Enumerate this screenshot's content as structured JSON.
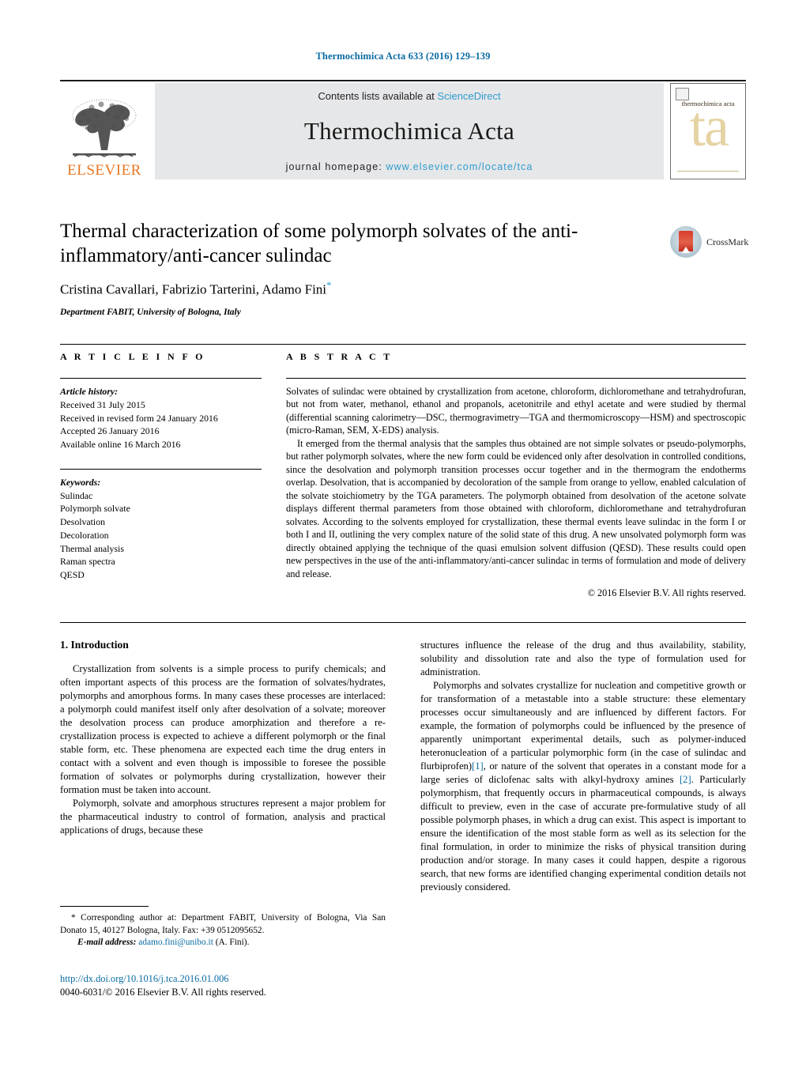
{
  "running_head": "Thermochimica Acta 633 (2016) 129–139",
  "masthead": {
    "publisher_name": "ELSEVIER",
    "publisher_logo_icon": "elsevier-tree-icon",
    "contents_prefix": "Contents lists available at ",
    "contents_link": "ScienceDirect",
    "journal_name": "Thermochimica Acta",
    "homepage_prefix": "journal homepage: ",
    "homepage_url": "www.elsevier.com/locate/tca",
    "cover_title": "thermochimica acta",
    "cover_monogram": "ta"
  },
  "title_block": {
    "title": "Thermal characterization of some polymorph solvates of the anti-inflammatory/anti-cancer sulindac",
    "authors": "Cristina Cavallari, Fabrizio Tarterini, Adamo Fini",
    "corresponding_marker": "*",
    "affiliation": "Department FABIT, University of Bologna, Italy",
    "crossmark_label": "CrossMark",
    "crossmark_icon": "crossmark-logo-icon"
  },
  "article_info": {
    "heading": "A R T I C L E   I N F O",
    "history_label": "Article history:",
    "history": [
      "Received 31 July 2015",
      "Received in revised form 24 January 2016",
      "Accepted 26 January 2016",
      "Available online 16 March 2016"
    ],
    "keywords_label": "Keywords:",
    "keywords": [
      "Sulindac",
      "Polymorph solvate",
      "Desolvation",
      "Decoloration",
      "Thermal analysis",
      "Raman spectra",
      "QESD"
    ]
  },
  "abstract": {
    "heading": "A B S T R A C T",
    "paragraphs": [
      "Solvates of sulindac were obtained by crystallization from acetone, chloroform, dichloromethane and tetrahydrofuran, but not from water, methanol, ethanol and propanols, acetonitrile and ethyl acetate and were studied by thermal (differential scanning calorimetry—DSC, thermogravimetry—TGA and thermomicroscopy—HSM) and spectroscopic (micro-Raman, SEM, X-EDS) analysis.",
      "It emerged from the thermal analysis that the samples thus obtained are not simple solvates or pseudo-polymorphs, but rather polymorph solvates, where the new form could be evidenced only after desolvation in controlled conditions, since the desolvation and polymorph transition processes occur together and in the thermogram the endotherms overlap. Desolvation, that is accompanied by decoloration of the sample from orange to yellow, enabled calculation of the solvate stoichiometry by the TGA parameters. The polymorph obtained from desolvation of the acetone solvate displays different thermal parameters from those obtained with chloroform, dichloromethane and tetrahydrofuran solvates. According to the solvents employed for crystallization, these thermal events leave sulindac in the form I or both I and II, outlining the very complex nature of the solid state of this drug. A new unsolvated polymorph form was directly obtained applying the technique of the quasi emulsion solvent diffusion (QESD). These results could open new perspectives in the use of the anti-inflammatory/anti-cancer sulindac in terms of formulation and mode of delivery and release."
    ],
    "copyright": "© 2016 Elsevier B.V. All rights reserved."
  },
  "body": {
    "section_number_title": "1.  Introduction",
    "left_paragraphs": [
      "Crystallization from solvents is a simple process to purify chemicals; and often important aspects of this process are the formation of solvates/hydrates, polymorphs and amorphous forms. In many cases these processes are interlaced: a polymorph could manifest itself only after desolvation of a solvate; moreover the desolvation process can produce amorphization and therefore a re-crystallization process is expected to achieve a different polymorph or the final stable form, etc. These phenomena are expected each time the drug enters in contact with a solvent and even though is impossible to foresee the possible formation of solvates or polymorphs during crystallization, however their formation must be taken into account.",
      "Polymorph, solvate and amorphous structures represent a major problem for the pharmaceutical industry to control of formation, analysis and practical applications of drugs, because these"
    ],
    "right_paragraph_continuation": "structures influence the release of the drug and thus availability, stability, solubility and dissolution rate and also the type of formulation used for administration.",
    "right_paragraph_parts": {
      "p1": "Polymorphs and solvates crystallize for nucleation and competitive growth or for transformation of a metastable into a stable structure: these elementary processes occur simultaneously and are influenced by different factors. For example, the formation of polymorphs could be influenced by the presence of apparently unimportant experimental details, such as polymer-induced heteronucleation of a particular polymorphic form (in the case of sulindac and flurbiprofen)",
      "ref1": "[1]",
      "p2": ", or nature of the solvent that operates in a constant mode for a large series of diclofenac salts with alkyl-hydroxy amines ",
      "ref2": "[2]",
      "p3": ". Particularly polymorphism, that frequently occurs in pharmaceutical compounds, is always difficult to preview, even in the case of accurate pre-formulative study of all possible polymorph phases, in which a drug can exist. This aspect is important to ensure the identification of the most stable form as well as its selection for the final formulation, in order to minimize the risks of physical transition during production and/or storage. In many cases it could happen, despite a rigorous search, that new forms are identified changing experimental condition details not previously considered."
    }
  },
  "footnotes": {
    "corresponding_marker": "*",
    "corresponding_text": "  Corresponding author at: Department FABIT, University of Bologna, Via San Donato 15, 40127 Bologna, Italy. Fax: +39 0512095652.",
    "email_label": "E-mail address:",
    "email": "adamo.fini@unibo.it",
    "email_suffix": " (A. Fini).",
    "doi_url": "http://dx.doi.org/10.1016/j.tca.2016.01.006",
    "issn_line": "0040-6031/© 2016 Elsevier B.V. All rights reserved."
  },
  "colors": {
    "link_blue": "#0a6ba3",
    "sciencedirect_blue": "#2e9bd0",
    "elsevier_orange": "#e87722",
    "banner_gray": "#e6e7e8"
  }
}
